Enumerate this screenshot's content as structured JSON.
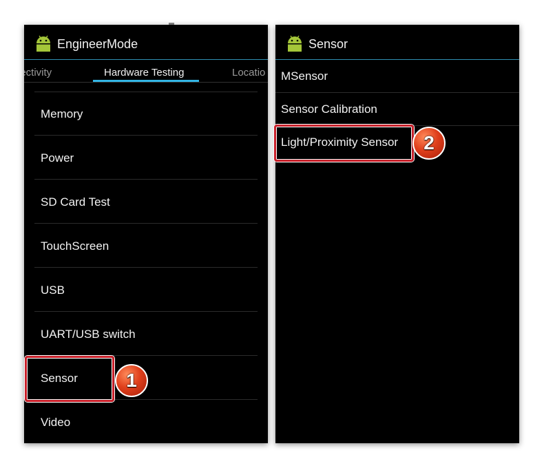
{
  "left_screen": {
    "app_title": "EngineerMode",
    "tabs": [
      {
        "label": "nectivity"
      },
      {
        "label": "Hardware Testing"
      },
      {
        "label": "Locatio"
      }
    ],
    "items": [
      {
        "label": "Memory"
      },
      {
        "label": "Power"
      },
      {
        "label": "SD Card Test"
      },
      {
        "label": "TouchScreen"
      },
      {
        "label": "USB"
      },
      {
        "label": "UART/USB switch"
      },
      {
        "label": "Sensor"
      },
      {
        "label": "Video"
      }
    ],
    "badge": "1"
  },
  "right_screen": {
    "app_title": "Sensor",
    "items": [
      {
        "label": "MSensor"
      },
      {
        "label": "Sensor Calibration"
      },
      {
        "label": "Light/Proximity Sensor"
      }
    ],
    "badge": "2"
  },
  "colors": {
    "accent": "#33b5e5",
    "highlight": "#c8202a",
    "android_green": "#a4c639"
  }
}
